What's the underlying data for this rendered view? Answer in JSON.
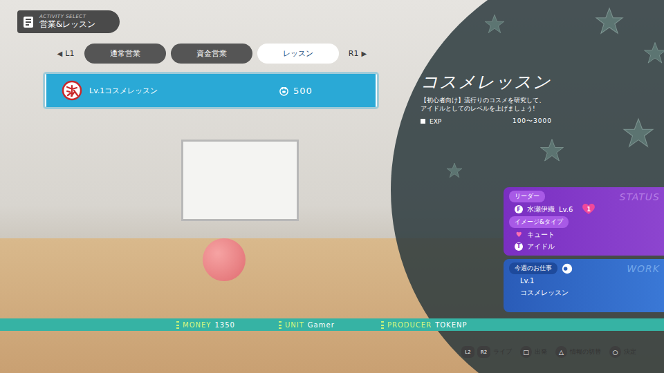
{
  "header": {
    "subtitle": "ACTIVITY SELECT",
    "title": "営業&レッスン"
  },
  "tabs": {
    "prev_icon": "◀",
    "prev": "L1",
    "next": "R1",
    "next_icon": "▶",
    "items": [
      {
        "label": "通常営業",
        "selected": false
      },
      {
        "label": "資金営業",
        "selected": false
      },
      {
        "label": "レッスン",
        "selected": true
      }
    ]
  },
  "lessons": [
    {
      "name": "Lv.1コスメレッスン",
      "cost": "500",
      "selected": true
    }
  ],
  "detail": {
    "title": "コスメレッスン",
    "description": [
      "【初心者向け】流行りのコスメを研究して、",
      "アイドルとしてのレベルを上げましょう!"
    ],
    "exp_label": "EXP",
    "exp_range": "100〜3000"
  },
  "status": {
    "watermark": "STATUS",
    "leader_label": "リーダー",
    "leader": {
      "badge": "F",
      "name": "水瀬伊織",
      "level": "Lv.6",
      "hearts": "1"
    },
    "image_label": "イメージ&タイプ",
    "image": {
      "icon": "♥",
      "text": "キュート"
    },
    "type": {
      "badge": "T",
      "text": "アイドル"
    }
  },
  "work": {
    "watermark": "WORK",
    "label": "今週のお仕事",
    "level": "Lv.1",
    "name": "コスメレッスン"
  },
  "info_bar": [
    {
      "label": "MONEY",
      "value": "1350"
    },
    {
      "label": "UNIT",
      "value": "Gamer"
    },
    {
      "label": "PRODUCER",
      "value": "TOKENP"
    }
  ],
  "controls": [
    {
      "keys": [
        "L2",
        "R2"
      ],
      "label": "ライブ"
    },
    {
      "keys": [
        "□"
      ],
      "label": "出発"
    },
    {
      "keys": [
        "△"
      ],
      "label": "情報の切替"
    },
    {
      "keys": [
        "○"
      ],
      "label": "決定"
    }
  ]
}
